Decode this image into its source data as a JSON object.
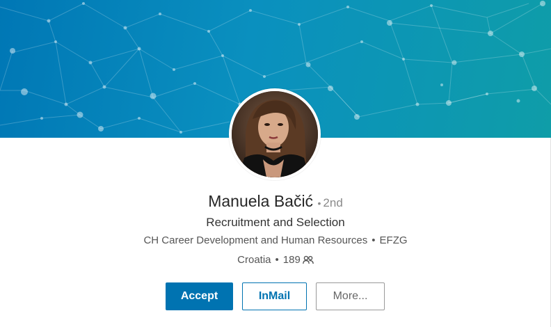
{
  "profile": {
    "name": "Manuela Bačić",
    "degree_separator": "•",
    "degree": "2nd",
    "headline": "Recruitment and Selection",
    "company": "CH Career Development and Human Resources",
    "school": "EFZG",
    "location": "Croatia",
    "connections": "189",
    "bullet": "•"
  },
  "actions": {
    "accept_label": "Accept",
    "inmail_label": "InMail",
    "more_label": "More..."
  },
  "icons": {
    "connections": "people-icon"
  },
  "colors": {
    "banner_start": "#0077b5",
    "banner_end": "#0f9da8",
    "primary": "#0073b1"
  }
}
